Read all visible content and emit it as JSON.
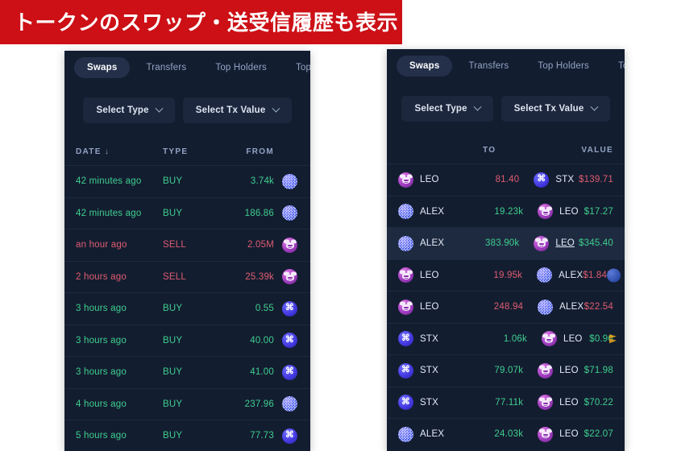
{
  "banner": {
    "text": "トークンのスワップ・送受信履歴も表示"
  },
  "panel_left": {
    "tabs": [
      {
        "label": "Swaps",
        "active": true
      },
      {
        "label": "Transfers",
        "active": false
      },
      {
        "label": "Top Holders",
        "active": false
      },
      {
        "label": "Top Tr",
        "active": false
      }
    ],
    "filters": [
      {
        "label": "Select Type"
      },
      {
        "label": "Select Tx Value"
      }
    ],
    "columns": [
      "DATE",
      "TYPE",
      "FROM"
    ],
    "sort": {
      "column": "DATE",
      "direction": "↓"
    },
    "rows": [
      {
        "date": "42 minutes ago",
        "type": "BUY",
        "from": "3.74k",
        "dir": "buy",
        "token": "alex"
      },
      {
        "date": "42 minutes ago",
        "type": "BUY",
        "from": "186.86",
        "dir": "buy",
        "token": "alex"
      },
      {
        "date": "an hour ago",
        "type": "SELL",
        "from": "2.05M",
        "dir": "sell",
        "token": "leo"
      },
      {
        "date": "2 hours ago",
        "type": "SELL",
        "from": "25.39k",
        "dir": "sell",
        "token": "leo"
      },
      {
        "date": "3 hours ago",
        "type": "BUY",
        "from": "0.55",
        "dir": "buy",
        "token": "stx"
      },
      {
        "date": "3 hours ago",
        "type": "BUY",
        "from": "40.00",
        "dir": "buy",
        "token": "stx"
      },
      {
        "date": "3 hours ago",
        "type": "BUY",
        "from": "41.00",
        "dir": "buy",
        "token": "stx"
      },
      {
        "date": "4 hours ago",
        "type": "BUY",
        "from": "237.96",
        "dir": "buy",
        "token": "alex"
      },
      {
        "date": "5 hours ago",
        "type": "BUY",
        "from": "77.73",
        "dir": "buy",
        "token": "stx"
      }
    ]
  },
  "panel_right": {
    "tabs": [
      {
        "label": "Swaps",
        "active": true
      },
      {
        "label": "Transfers",
        "active": false
      },
      {
        "label": "Top Holders",
        "active": false
      },
      {
        "label": "Top Tr",
        "active": false
      }
    ],
    "filters": [
      {
        "label": "Select Type"
      },
      {
        "label": "Select Tx Value"
      }
    ],
    "columns": [
      "TO",
      "VALUE"
    ],
    "rows": [
      {
        "from_token": "leo",
        "from_name": "LEO",
        "amount": "81.40",
        "to_token": "stx",
        "to_name": "STX",
        "value": "$139.71",
        "dir": "sell",
        "highlight": false,
        "underline": false,
        "edge": ""
      },
      {
        "from_token": "alex",
        "from_name": "ALEX",
        "amount": "19.23k",
        "to_token": "leo",
        "to_name": "LEO",
        "value": "$17.27",
        "dir": "buy",
        "highlight": false,
        "underline": false,
        "edge": ""
      },
      {
        "from_token": "alex",
        "from_name": "ALEX",
        "amount": "383.90k",
        "to_token": "leo",
        "to_name": "LEO",
        "value": "$345.40",
        "dir": "buy",
        "highlight": true,
        "underline": true,
        "edge": ""
      },
      {
        "from_token": "leo",
        "from_name": "LEO",
        "amount": "19.95k",
        "to_token": "alex",
        "to_name": "ALEX",
        "value": "$1.84K",
        "dir": "sell",
        "highlight": false,
        "underline": false,
        "edge": "blue"
      },
      {
        "from_token": "leo",
        "from_name": "LEO",
        "amount": "248.94",
        "to_token": "alex",
        "to_name": "ALEX",
        "value": "$22.54",
        "dir": "sell",
        "highlight": false,
        "underline": false,
        "edge": ""
      },
      {
        "from_token": "stx",
        "from_name": "STX",
        "amount": "1.06k",
        "to_token": "leo",
        "to_name": "LEO",
        "value": "$0.96",
        "dir": "buy",
        "highlight": false,
        "underline": false,
        "edge": "gold"
      },
      {
        "from_token": "stx",
        "from_name": "STX",
        "amount": "79.07k",
        "to_token": "leo",
        "to_name": "LEO",
        "value": "$71.98",
        "dir": "buy",
        "highlight": false,
        "underline": false,
        "edge": ""
      },
      {
        "from_token": "stx",
        "from_name": "STX",
        "amount": "77.11k",
        "to_token": "leo",
        "to_name": "LEO",
        "value": "$70.22",
        "dir": "buy",
        "highlight": false,
        "underline": false,
        "edge": ""
      },
      {
        "from_token": "alex",
        "from_name": "ALEX",
        "amount": "24.03k",
        "to_token": "leo",
        "to_name": "LEO",
        "value": "$22.07",
        "dir": "buy",
        "highlight": false,
        "underline": false,
        "edge": ""
      }
    ]
  },
  "colors": {
    "banner_bg": "#cc1016",
    "panel_bg": "#131d30",
    "row_highlight": "#1e2a40",
    "buy": "#3ecf8e",
    "sell": "#e05c70",
    "tab_active_bg": "#24304a",
    "muted_text": "#93a4c4"
  },
  "icons": {
    "chevron_down": "chevron-down-icon",
    "sort_arrow": "↓",
    "stx_glyph": "⌘"
  }
}
